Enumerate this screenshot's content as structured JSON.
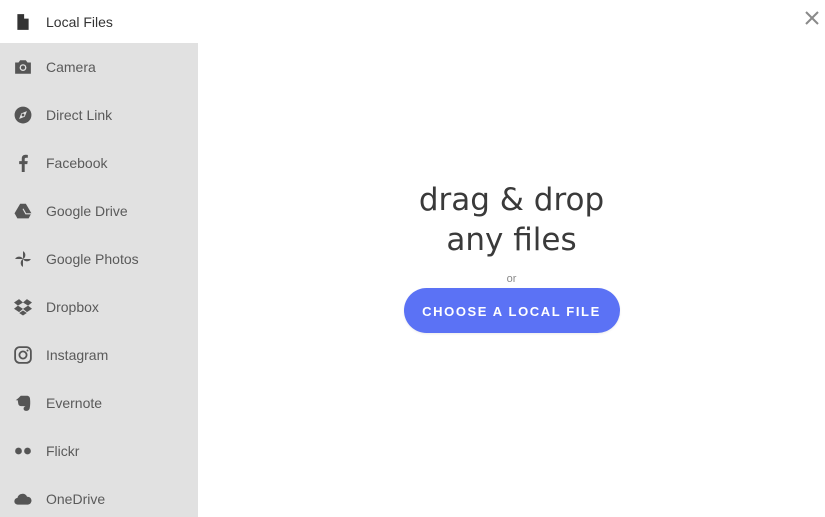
{
  "sidebar": {
    "items": [
      {
        "label": "Local Files",
        "icon": "file-icon",
        "active": true
      },
      {
        "label": "Camera",
        "icon": "camera-icon"
      },
      {
        "label": "Direct Link",
        "icon": "compass-icon"
      },
      {
        "label": "Facebook",
        "icon": "facebook-icon"
      },
      {
        "label": "Google Drive",
        "icon": "google-drive-icon"
      },
      {
        "label": "Google Photos",
        "icon": "google-photos-icon"
      },
      {
        "label": "Dropbox",
        "icon": "dropbox-icon"
      },
      {
        "label": "Instagram",
        "icon": "instagram-icon"
      },
      {
        "label": "Evernote",
        "icon": "evernote-icon"
      },
      {
        "label": "Flickr",
        "icon": "flickr-icon"
      },
      {
        "label": "OneDrive",
        "icon": "onedrive-icon"
      }
    ]
  },
  "main": {
    "title_line1": "drag & drop",
    "title_line2": "any files",
    "or_text": "or",
    "choose_button": "CHOOSE A LOCAL FILE"
  },
  "colors": {
    "accent": "#5b72f5",
    "sidebar_bg": "#e1e1e1"
  }
}
